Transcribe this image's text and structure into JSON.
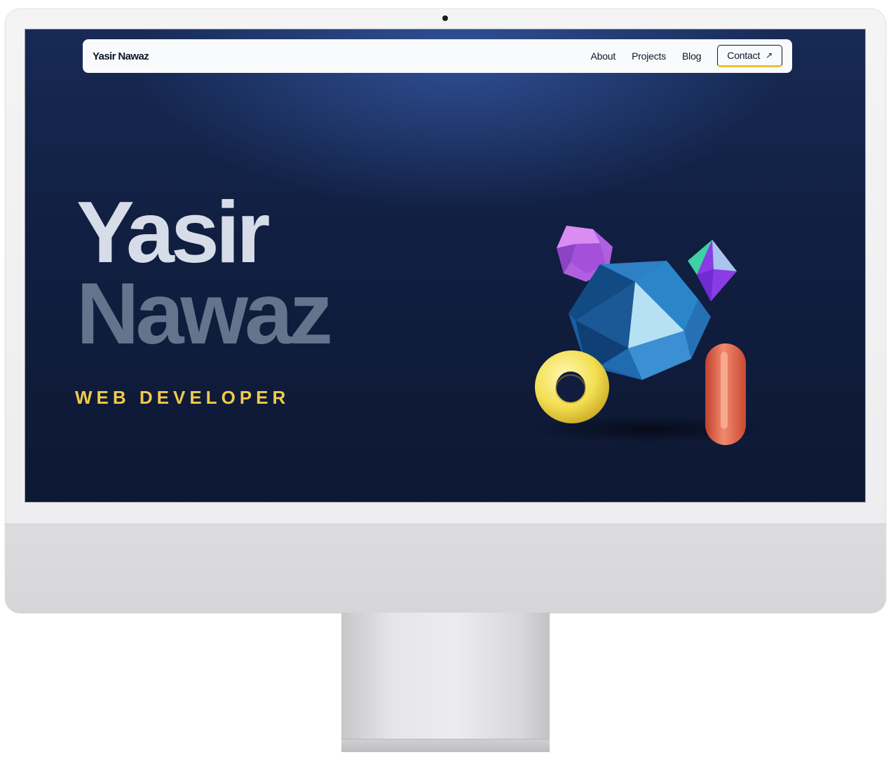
{
  "navbar": {
    "brand": "Yasir Nawaz",
    "links": [
      {
        "label": "About"
      },
      {
        "label": "Projects"
      },
      {
        "label": "Blog"
      }
    ],
    "contact_label": "Contact",
    "contact_icon": "arrow-up-right-icon"
  },
  "hero": {
    "first_name": "Yasir",
    "last_name": "Nawaz",
    "role": "WEB DEVELOPER"
  },
  "colors": {
    "background": "#111f42",
    "accent": "#f2c94c",
    "name_light": "#d6dde8",
    "name_muted": "#65748d"
  }
}
